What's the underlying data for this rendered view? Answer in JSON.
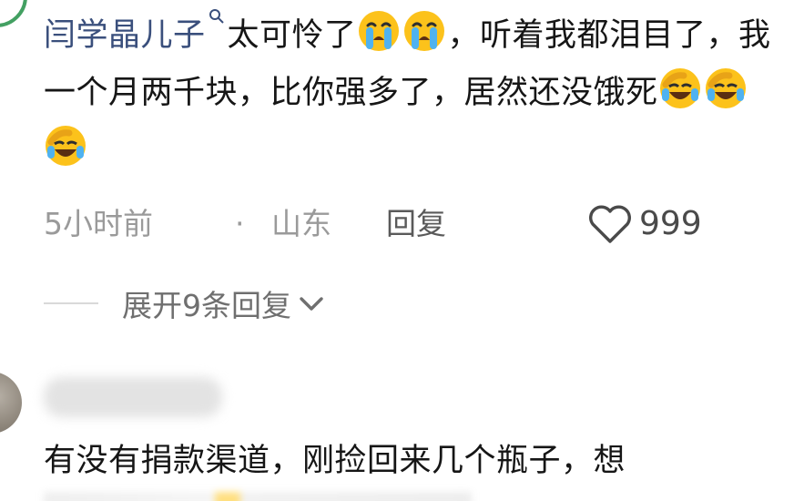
{
  "comment": {
    "author": "闫学晶儿子",
    "text_after_author": "太可怜了",
    "text_after_emojis": "，听着我都泪目了，我一个月两千块，比你强多了，居然还没饿死",
    "emoji_set_1": [
      "crying-face",
      "crying-face"
    ],
    "emoji_set_2": [
      "rolling-laughing-face",
      "rolling-laughing-face",
      "rolling-laughing-face"
    ],
    "time": "5小时前",
    "separator": "·",
    "location": "山东",
    "reply_label": "回复",
    "like_count": "999",
    "expand_label": "展开9条回复"
  },
  "comment2": {
    "text": "有没有捐款渠道，刚捡回来几个瓶子，想"
  },
  "colors": {
    "author": "#3a4f7c",
    "text": "#161616",
    "meta": "#9a9a9a",
    "avatar_ring": "#43a062"
  }
}
